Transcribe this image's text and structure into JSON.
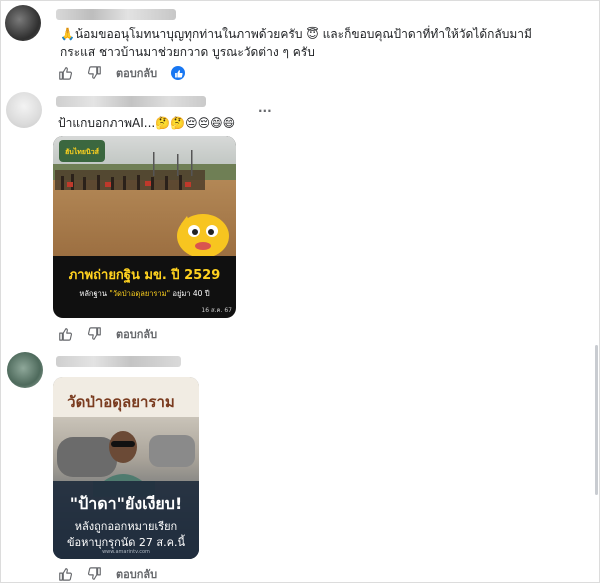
{
  "comments": [
    {
      "text_line1": "🙏น้อมขออนุโมทนาบุญทุกท่านในภาพด้วยครับ 😇 และก็ขอบคุณป้าดาที่ทำให้วัดได้กลับมามี",
      "text_line2": "กระแส ชาวบ้านมาช่วยกวาด บูรณะวัดต่าง ๆ ครับ",
      "reply_label": "ตอบกลับ"
    },
    {
      "text": "ป้าแกบอกภาพAI...🤔🤔😔😔😄😄",
      "reply_label": "ตอบกลับ",
      "more_label": "···",
      "image": {
        "logo_text": "ฮับไทยนิวส์",
        "headline": "ภาพถ่ายกฐิน มข. ปี 2529",
        "subline_prefix": "หลักฐาน",
        "subline_quote": "\"วัดป่าอดุลยาราม\"",
        "subline_suffix": "อยู่มา 40 ปี",
        "date": "16 ส.ค. 67"
      }
    },
    {
      "reply_label": "ตอบกลับ",
      "image": {
        "sign_text": "วัดป่าอดุลยาราม",
        "headline_quote": "\"ป้าดา\"",
        "headline_rest": "ยังเงียบ!",
        "sub_line1": "หลังถูกออกหมายเรียก",
        "sub_line2": "ข้อหาบุกรุกนัด 27 ส.ค.นี้",
        "watermark": "www.amarintv.com"
      }
    }
  ],
  "colors": {
    "reaction_blue": "#1877f2",
    "headline_yellow": "#ffd21f",
    "muted_text": "#65676b"
  },
  "icons": [
    "like-icon",
    "dislike-icon",
    "like-reaction-icon"
  ]
}
